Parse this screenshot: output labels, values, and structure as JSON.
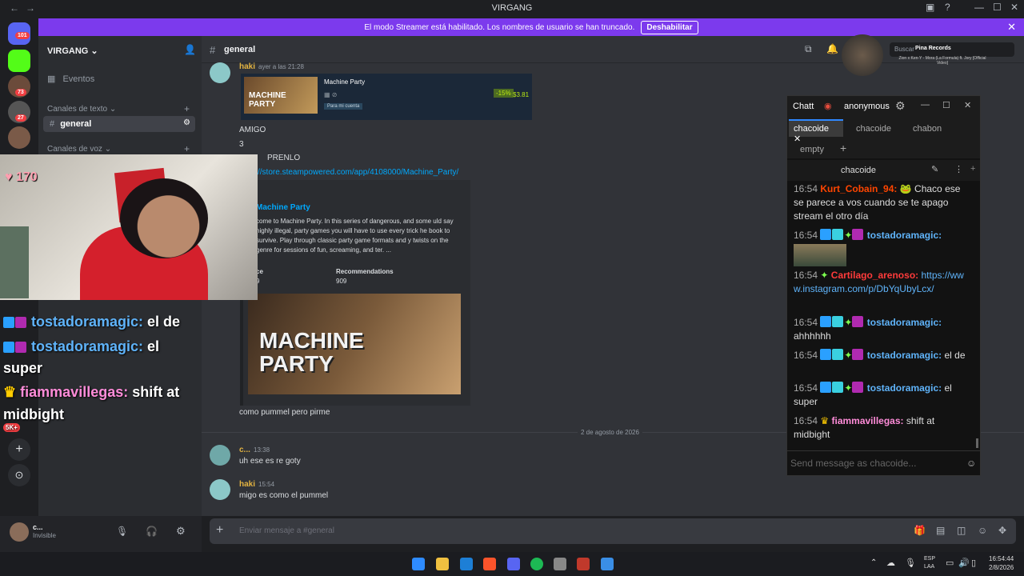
{
  "window": {
    "title": "VIRGANG"
  },
  "banner": {
    "message": "El modo Streamer está habilitado. Los nombres de usuario se han truncado.",
    "button": "Deshabilitar"
  },
  "rail": {
    "badges": [
      "101",
      "73",
      "27"
    ]
  },
  "sidebar": {
    "server_name": "VIRGANG",
    "events": "Eventos",
    "text_category": "Canales de texto",
    "active_channel": "general",
    "voice_category": "Canales de voz"
  },
  "user_panel": {
    "name": "c...",
    "status": "Invisible"
  },
  "header": {
    "channel": "general",
    "search_placeholder": "Buscar"
  },
  "media": {
    "title": "Pina Records",
    "subtitle": "Zion x Ken-Y - Mora (La Formula) ft. Jory [Official Video]"
  },
  "messages": {
    "m1_user": "haki",
    "m1_time": "ayer a las 21:28",
    "steam_game": "Machine Party",
    "steam_discount": "-15%",
    "steam_price": "$3.81",
    "steam_button": "Para mi cuenta",
    "line_amigo": "AMIGO",
    "line_3": "3",
    "line_compra": "PRENLO",
    "link": "//store.steampowered.com/app/4108000/Machine_Party/",
    "embed_title": "Machine Party",
    "embed_desc": "come to Machine Party. In this series of dangerous, and some uld say highly illegal, party games you will have to use every trick he book to survive. Play through classic party game formats and y twists on the genre for sessions of fun, screaming, and ter. ...",
    "embed_field1_name": "ce",
    "embed_field1_value": "9",
    "embed_field2_name": "Recommendations",
    "embed_field2_value": "909",
    "embed_image_text": "MACHINE PARTY",
    "line_pummel": "como pummel pero pirme",
    "date_divider": "2 de agosto de 2026",
    "m2_user": "c...",
    "m2_time": "13:38",
    "m2_text": "uh ese es re goty",
    "m3_user": "haki",
    "m3_time": "15:54",
    "m3_text": "migo es como el pummel",
    "composer_placeholder": "Enviar mensaje a #general"
  },
  "chatt": {
    "title": "Chatt",
    "account": "anonymous",
    "tabs": [
      "chacoide",
      "chacoide",
      "chabon",
      "empty"
    ],
    "split_title": "chacoide",
    "input_placeholder": "Send message as chacoide...",
    "lines": [
      {
        "time": "16:54",
        "user": "Kurt_Cobain_94:",
        "color": "#ff4500",
        "text": "Chaco ese se parece a vos cuando se te apago stream el otro día"
      },
      {
        "time": "16:54",
        "user": "tostadoramagic:",
        "color": "#5fb3f9",
        "text": ""
      },
      {
        "time": "16:54",
        "user": "Cartilago_arenoso:",
        "color": "#ff3b3b",
        "text": "https://www.instagram.com/p/DbYqUbyLcx/"
      },
      {
        "time": "16:54",
        "user": "tostadoramagic:",
        "color": "#5fb3f9",
        "text": "ahhhhhh"
      },
      {
        "time": "16:54",
        "user": "tostadoramagic:",
        "color": "#5fb3f9",
        "text": "el de"
      },
      {
        "time": "16:54",
        "user": "tostadoramagic:",
        "color": "#5fb3f9",
        "text": "el super"
      },
      {
        "time": "16:54",
        "user": "fiammavillegas:",
        "color": "#ff8cd9",
        "text": "shift at midbight"
      }
    ]
  },
  "overlay": {
    "hearts": "170",
    "l1_user": "tostadoramagic:",
    "l1_text": " el de",
    "l2_user": "tostadoramagic:",
    "l2_text": " el",
    "l3_text": "super",
    "l4_user": "fiammavillegas:",
    "l4_text": " shift at",
    "l5_text": "midbight",
    "badge_5k": "5K+"
  },
  "taskbar": {
    "lang1": "ESP",
    "lang2": "LAA",
    "time": "16:54:44",
    "date": "2/8/2026"
  }
}
